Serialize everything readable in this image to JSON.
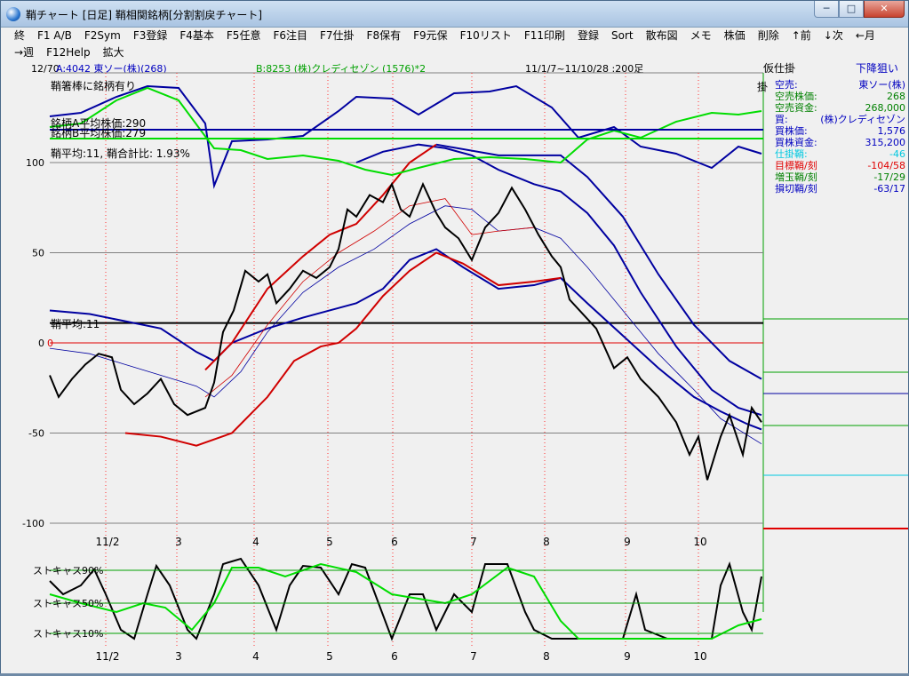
{
  "window": {
    "title": "鞘チャート [日足] 鞘相関銘柄[分割割戻チャート]",
    "btn_min": "─",
    "btn_max": "□",
    "btn_close": "✕"
  },
  "menu": {
    "row1": [
      "終",
      "F1 A/B",
      "F2Sym",
      "F3登録",
      "F4基本",
      "F5任意",
      "F6注目",
      "F7仕掛",
      "F8保有",
      "F9元保",
      "F10リスト",
      "F11印刷",
      "登録",
      "Sort",
      "散布図",
      "メモ",
      "株価",
      "削除",
      "↑前",
      "↓次",
      "←月"
    ],
    "row2": [
      "→週",
      "F12Help",
      "拡大"
    ]
  },
  "header": {
    "counter": "12/70",
    "stock_a": "A:4042 東ソー(株)(268)",
    "stock_b": "B:8253 (株)クレディセゾン (1576)*2",
    "period": "11/1/7~11/10/28 :200足",
    "status": "仮仕掛",
    "status_right": "下降狙い"
  },
  "notes": {
    "note1": "鞘箸棒に銘柄有り",
    "avg_a": "銘柄A平均株価:290",
    "avg_b": "銘柄B平均株価:279",
    "spread_avg": "鞘平均:11, 鞘合計比: 1.93%",
    "line_label": "鞘平均:11",
    "zero_label": "0",
    "kake": "掛"
  },
  "chart_data": {
    "type": "line",
    "x_ticks": [
      "11/2",
      "3",
      "4",
      "5",
      "6",
      "7",
      "8",
      "9",
      "10"
    ],
    "y_ticks": [
      "100",
      "50",
      "0",
      "-50",
      "-100"
    ],
    "ylim": [
      -110,
      150
    ],
    "stoch_labels": [
      "ストキャス90%",
      "ストキャス50%",
      "ストキャス10%"
    ],
    "reference_lines": {
      "spread_avg": 11,
      "zero": 0
    },
    "colors": {
      "spread": "#000000",
      "upper_band": "#0000a0",
      "lower_band": "#d00000",
      "price_a": "#0000a0",
      "price_b": "#00dd00",
      "grid": "#ff0000"
    }
  },
  "side_panel": {
    "rows": [
      {
        "label": "空売:",
        "value": "東ソー(株)",
        "color": "#0000c0"
      },
      {
        "label": "空売株価:",
        "value": "268",
        "color": "#008000"
      },
      {
        "label": "空売資金:",
        "value": "268,000",
        "color": "#008000"
      },
      {
        "label": "買:",
        "value": "(株)クレディセゾン",
        "color": "#0000c0"
      },
      {
        "label": "買株価:",
        "value": "1,576",
        "color": "#0000c0"
      },
      {
        "label": "買株資金:",
        "value": "315,200",
        "color": "#0000c0"
      },
      {
        "label": "仕掛鞘:",
        "value": "-46",
        "color": "#00c8e0"
      },
      {
        "label": "目標鞘/刻",
        "value": "-104/58",
        "color": "#e00000"
      },
      {
        "label": "増玉鞘/刻",
        "value": "-17/29",
        "color": "#008000"
      },
      {
        "label": "損切鞘/刻",
        "value": "-63/17",
        "color": "#0000c0"
      }
    ]
  }
}
